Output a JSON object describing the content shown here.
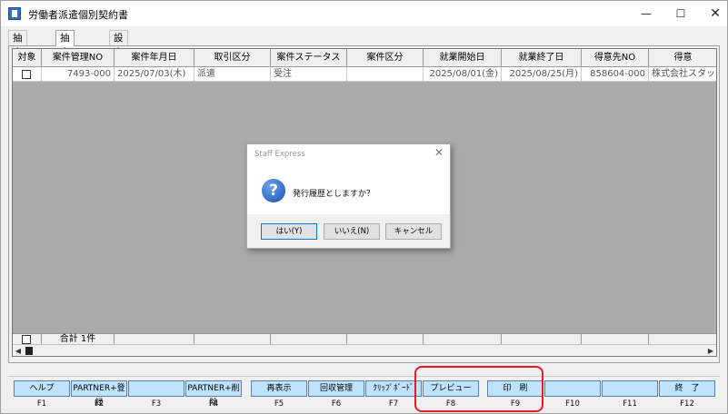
{
  "window": {
    "title": "労働者派遣個別契約書",
    "min_glyph": "—",
    "max_glyph": "☐",
    "close_glyph": "✕"
  },
  "tabs": [
    {
      "label": "抽出条件",
      "active": false
    },
    {
      "label": "抽出結果",
      "active": true
    },
    {
      "label": "設定",
      "active": false
    }
  ],
  "grid": {
    "columns": [
      "対象",
      "案件管理NO",
      "案件年月日",
      "取引区分",
      "案件ステータス",
      "案件区分",
      "就業開始日",
      "就業終了日",
      "得意先NO",
      "得意"
    ],
    "rows": [
      {
        "checked": false,
        "cells": [
          "7493-000",
          "2025/07/03(木)",
          "派遣",
          "受注",
          "",
          "2025/08/01(金)",
          "2025/08/25(月)",
          "858604-000",
          "株式会社スタッ"
        ]
      }
    ],
    "footer": {
      "total_label": "合計 1件"
    }
  },
  "dialog": {
    "title": "Staff Express",
    "close_glyph": "✕",
    "icon_glyph": "?",
    "message": "発行履歴としますか？",
    "buttons": {
      "yes": "はい(Y)",
      "no": "いいえ(N)",
      "cancel": "キャンセル"
    }
  },
  "function_keys": [
    {
      "key": "F1",
      "label": "ヘルプ"
    },
    {
      "key": "F2",
      "label": "PARTNER+登録"
    },
    {
      "key": "F3",
      "label": ""
    },
    {
      "key": "F4",
      "label": "PARTNER+削除"
    },
    {
      "key": "F5",
      "label": "再表示"
    },
    {
      "key": "F6",
      "label": "回収管理"
    },
    {
      "key": "F7",
      "label": "ｸﾘｯﾌﾟﾎﾞｰﾄﾞ"
    },
    {
      "key": "F8",
      "label": "プレビュー"
    },
    {
      "key": "F9",
      "label": "印　刷"
    },
    {
      "key": "F10",
      "label": ""
    },
    {
      "key": "F11",
      "label": ""
    },
    {
      "key": "F12",
      "label": "終　了"
    }
  ],
  "colors": {
    "fkey_bg": "#bfe2ff",
    "highlight": "#e81b23",
    "dialog_accent": "#0078d7"
  }
}
